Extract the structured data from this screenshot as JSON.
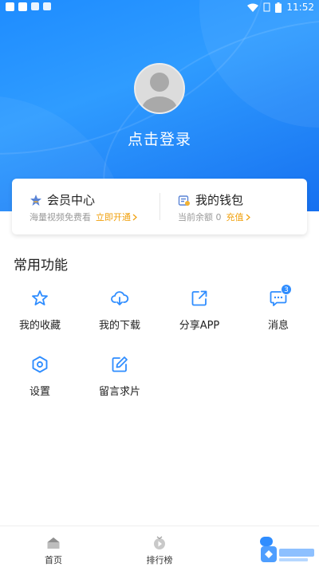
{
  "status_bar": {
    "time": "11:52"
  },
  "profile": {
    "login_label": "点击登录"
  },
  "member_card": {
    "vip": {
      "title": "会员中心",
      "subtitle": "海量视频免费看",
      "action": "立即开通"
    },
    "wallet": {
      "title": "我的钱包",
      "subtitle": "当前余额 0",
      "action": "充值"
    }
  },
  "functions": {
    "section_title": "常用功能",
    "items": [
      {
        "label": "我的收藏",
        "icon": "star-icon"
      },
      {
        "label": "我的下载",
        "icon": "cloud-download-icon"
      },
      {
        "label": "分享APP",
        "icon": "share-icon"
      },
      {
        "label": "消息",
        "icon": "message-icon",
        "badge": "3"
      },
      {
        "label": "设置",
        "icon": "settings-icon"
      },
      {
        "label": "留言求片",
        "icon": "edit-icon"
      }
    ]
  },
  "tabbar": {
    "tabs": [
      {
        "label": "首页",
        "icon": "home-icon"
      },
      {
        "label": "排行榜",
        "icon": "ranking-icon"
      }
    ]
  },
  "colors": {
    "primary": "#2f8dff",
    "accent": "#f0a00c",
    "header": "#1e8cff"
  }
}
